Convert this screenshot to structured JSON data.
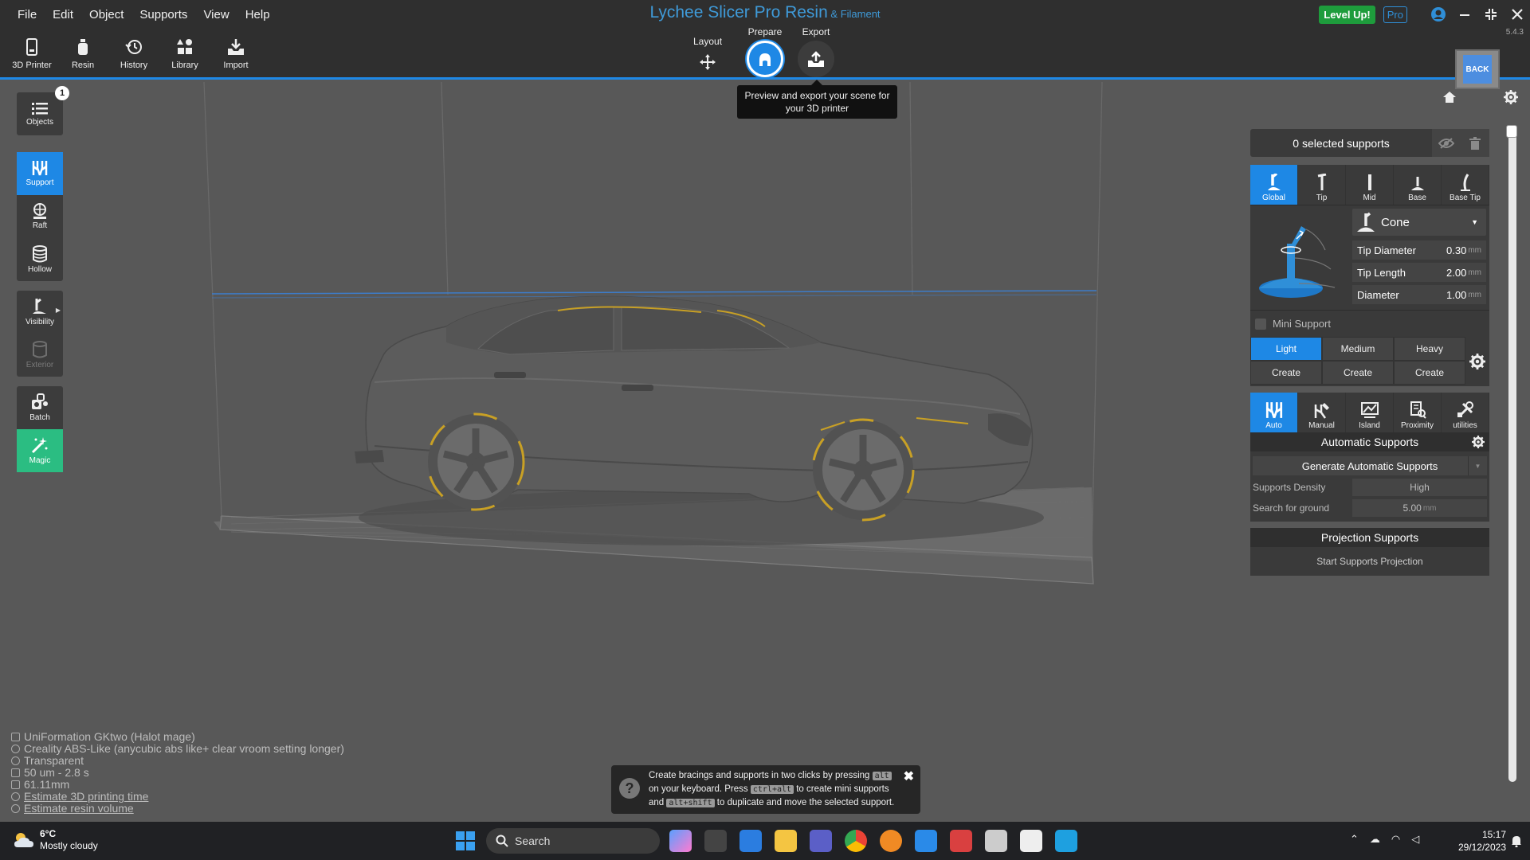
{
  "app": {
    "title": "Lychee Slicer Pro Resin",
    "subtitle": "& Filament",
    "version": "5.4.3",
    "level_up": "Level Up!",
    "pro_badge": "Pro"
  },
  "menu": [
    "File",
    "Edit",
    "Object",
    "Supports",
    "View",
    "Help"
  ],
  "toolbar": [
    "3D Printer",
    "Resin",
    "History",
    "Library",
    "Import"
  ],
  "modes": {
    "layout": "Layout",
    "prepare": "Prepare",
    "export": "Export"
  },
  "tooltip": "Preview and export your scene for your 3D printer",
  "back_button": "BACK",
  "left_tools": {
    "objects": "Objects",
    "objects_badge": "1",
    "support": "Support",
    "raft": "Raft",
    "hollow": "Hollow",
    "visibility": "Visibility",
    "exterior": "Exterior",
    "batch": "Batch",
    "magic": "Magic"
  },
  "panel": {
    "selected": "0 selected supports",
    "type_tabs": [
      "Global",
      "Tip",
      "Mid",
      "Base",
      "Base Tip"
    ],
    "tip_shape": "Cone",
    "params": [
      {
        "label": "Tip Diameter",
        "value": "0.30",
        "unit": "mm"
      },
      {
        "label": "Tip Length",
        "value": "2.00",
        "unit": "mm"
      },
      {
        "label": "Diameter",
        "value": "1.00",
        "unit": "mm"
      }
    ],
    "mini_support": "Mini Support",
    "density": [
      "Light",
      "Medium",
      "Heavy"
    ],
    "create": [
      "Create",
      "Create",
      "Create"
    ],
    "auto_tabs": [
      "Auto",
      "Manual",
      "Island",
      "Proximity",
      "utilities"
    ],
    "auto_title": "Automatic Supports",
    "generate": "Generate Automatic Supports",
    "density_label": "Supports Density",
    "density_value": "High",
    "ground_label": "Search for ground",
    "ground_value": "5.00",
    "ground_unit": "mm",
    "projection_title": "Projection Supports",
    "projection_button": "Start Supports Projection"
  },
  "info": {
    "printer": "UniFormation GKtwo (Halot mage)",
    "resin": "Creality ABS-Like (anycubic abs like+ clear vroom setting longer)",
    "mode": "Transparent",
    "layers": "50 um - 2.8 s",
    "height": "61.11mm",
    "estimate_time": "Estimate 3D printing time",
    "estimate_volume": "Estimate resin volume"
  },
  "hint": {
    "p1": "Create bracings and supports in two clicks by pressing",
    "k1": "alt",
    "p2": "on your keyboard. Press",
    "k2": "ctrl+alt",
    "p3": "to create mini supports",
    "p4": "and",
    "k3": "alt+shift",
    "p5": "to duplicate and move the selected support."
  },
  "taskbar": {
    "temp": "6°C",
    "weather": "Mostly cloudy",
    "search": "Search",
    "time": "15:17",
    "date": "29/12/2023"
  },
  "colors": {
    "accent": "#1e88e5",
    "magic": "#2bbd82",
    "level": "#1e9c3c",
    "viewport": "#585858",
    "model_highlight": "#c8a025"
  }
}
